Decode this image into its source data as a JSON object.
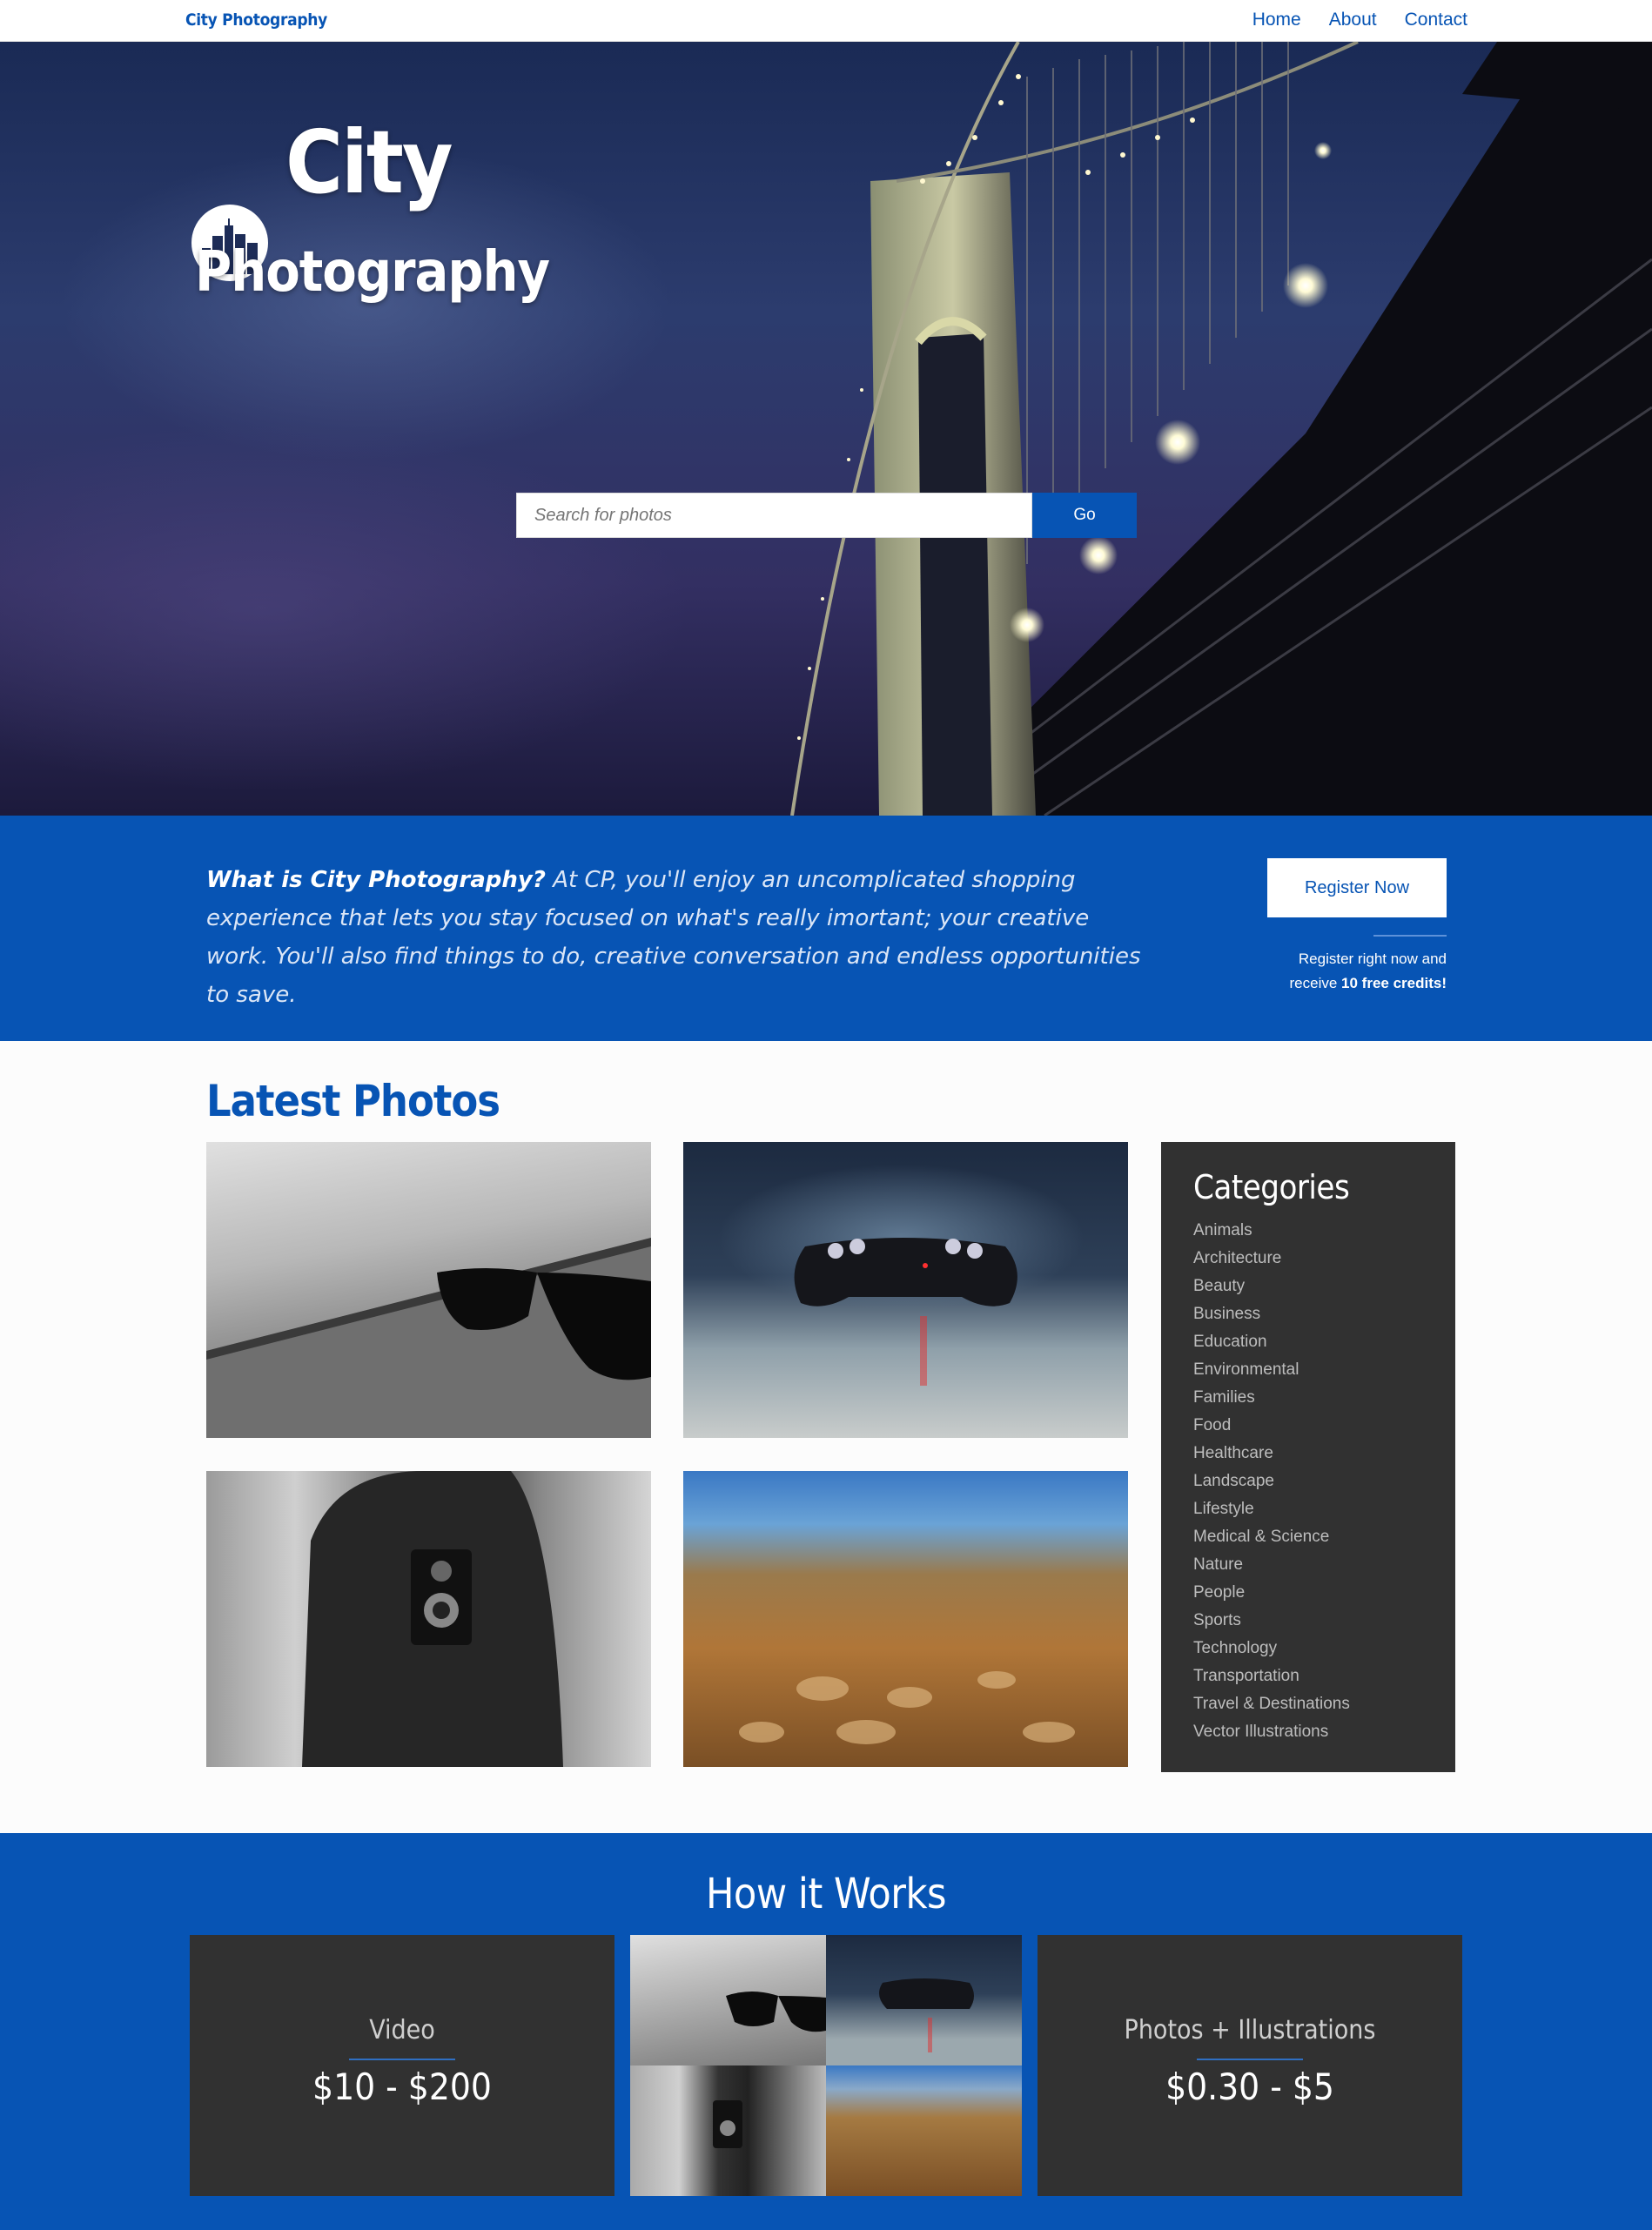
{
  "nav": {
    "brand": "City Photography",
    "links": [
      "Home",
      "About",
      "Contact"
    ]
  },
  "hero": {
    "logo_line1": "City",
    "logo_line2": "Photography",
    "search_placeholder": "Search for photos",
    "search_button": "Go"
  },
  "intro": {
    "question": "What is City Photography?",
    "body": " At CP, you'll enjoy an uncomplicated shopping experience that lets you stay focused on what's really imortant; your creative work. You'll also find things to do, creative conversation and endless opportunities to save.",
    "register_button": "Register Now",
    "register_note_1": "Register right now and",
    "register_note_2": "receive ",
    "register_note_bold": "10 free credits!"
  },
  "latest": {
    "title": "Latest Photos",
    "photos": [
      "sunglasses",
      "game-controller",
      "person-with-camera",
      "seashells-beach"
    ]
  },
  "categories": {
    "title": "Categories",
    "items": [
      "Animals",
      "Architecture",
      "Beauty",
      "Business",
      "Education",
      "Environmental",
      "Families",
      "Food",
      "Healthcare",
      "Landscape",
      "Lifestyle",
      "Medical & Science",
      "Nature",
      "People",
      "Sports",
      "Technology",
      "Transportation",
      "Travel & Destinations",
      "Vector Illustrations"
    ]
  },
  "how": {
    "title": "How it Works",
    "video_name": "Video",
    "video_price": "$10 - $200",
    "photos_name": "Photos + Illustrations",
    "photos_price": "$0.30 - $5"
  },
  "colors": {
    "brand_blue": "#0754b4",
    "dark_panel": "#313131"
  }
}
